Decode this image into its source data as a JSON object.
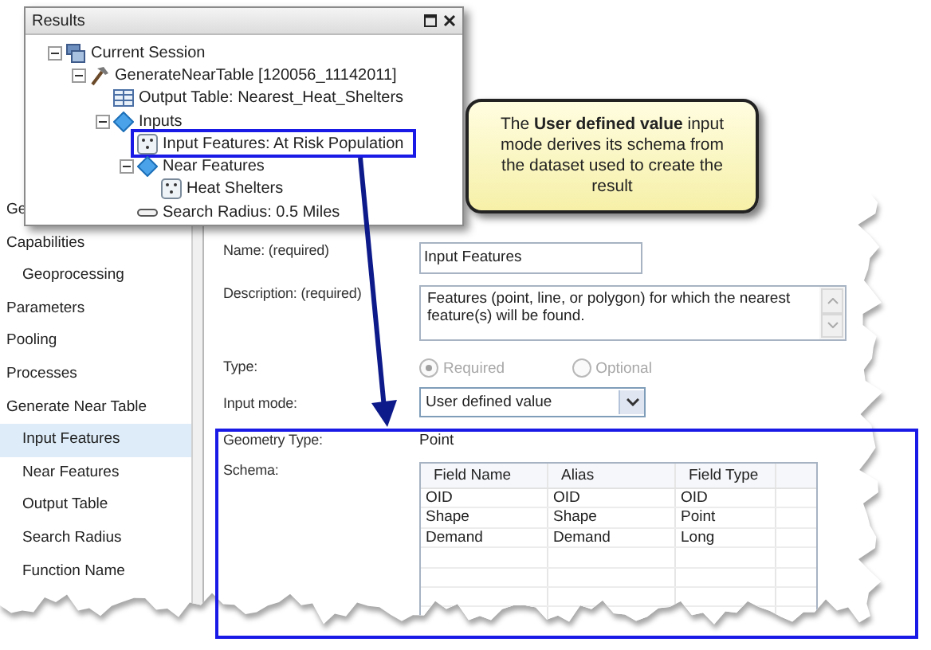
{
  "results_window": {
    "title": "Results",
    "tree": [
      {
        "label": "Current Session",
        "kind": "session",
        "expanded": true,
        "children": [
          {
            "label": "GenerateNearTable [120056_11142011]",
            "kind": "tool",
            "expanded": true,
            "children": [
              {
                "label": "Output Table: Nearest_Heat_Shelters",
                "kind": "table"
              },
              {
                "label": "Inputs",
                "kind": "diamond",
                "expanded": true,
                "children": [
                  {
                    "label": "Input Features: At Risk Population",
                    "kind": "points",
                    "highlighted": true
                  },
                  {
                    "label": "Near Features",
                    "kind": "diamond",
                    "expanded": true,
                    "children": [
                      {
                        "label": "Heat Shelters",
                        "kind": "points"
                      }
                    ]
                  },
                  {
                    "label": "Search Radius: 0.5 Miles",
                    "kind": "bar"
                  }
                ]
              }
            ]
          }
        ]
      }
    ]
  },
  "callout": {
    "text": "The **User defined value** input mode derives its schema from the dataset used to create the result"
  },
  "sidebar": {
    "items": [
      {
        "label": "Ge",
        "selected": false
      },
      {
        "label": "Capabilities",
        "selected": false,
        "children": [
          {
            "label": "Geoprocessing",
            "selected": false
          }
        ]
      },
      {
        "label": "Parameters",
        "selected": false
      },
      {
        "label": "Pooling",
        "selected": false
      },
      {
        "label": "Processes",
        "selected": false
      },
      {
        "label": "Generate Near Table",
        "selected": false,
        "children": [
          {
            "label": "Input Features",
            "selected": true
          },
          {
            "label": "Near Features",
            "selected": false
          },
          {
            "label": "Output Table",
            "selected": false
          },
          {
            "label": "Search Radius",
            "selected": false
          },
          {
            "label": "Function Name",
            "selected": false
          }
        ]
      }
    ]
  },
  "form": {
    "name": {
      "label": "Name: (required)",
      "value": "Input Features"
    },
    "description": {
      "label": "Description: (required)",
      "value": "Features (point, line, or polygon) for which the nearest feature(s) will be found."
    },
    "type": {
      "label": "Type:",
      "disabled": true,
      "options": [
        {
          "label": "Required",
          "selected": true
        },
        {
          "label": "Optional",
          "selected": false
        }
      ]
    },
    "input_mode": {
      "label": "Input mode:",
      "value": "User defined value"
    },
    "schema_section": {
      "highlighted": true,
      "geometry_type": {
        "label": "Geometry Type:",
        "value": "Point"
      },
      "schema": {
        "label": "Schema:",
        "columns": [
          "Field Name",
          "Alias",
          "Field Type"
        ],
        "rows": [
          [
            "OID",
            "OID",
            "OID"
          ],
          [
            "Shape",
            "Shape",
            "Point"
          ],
          [
            "Demand",
            "Demand",
            "Long"
          ]
        ]
      }
    }
  }
}
